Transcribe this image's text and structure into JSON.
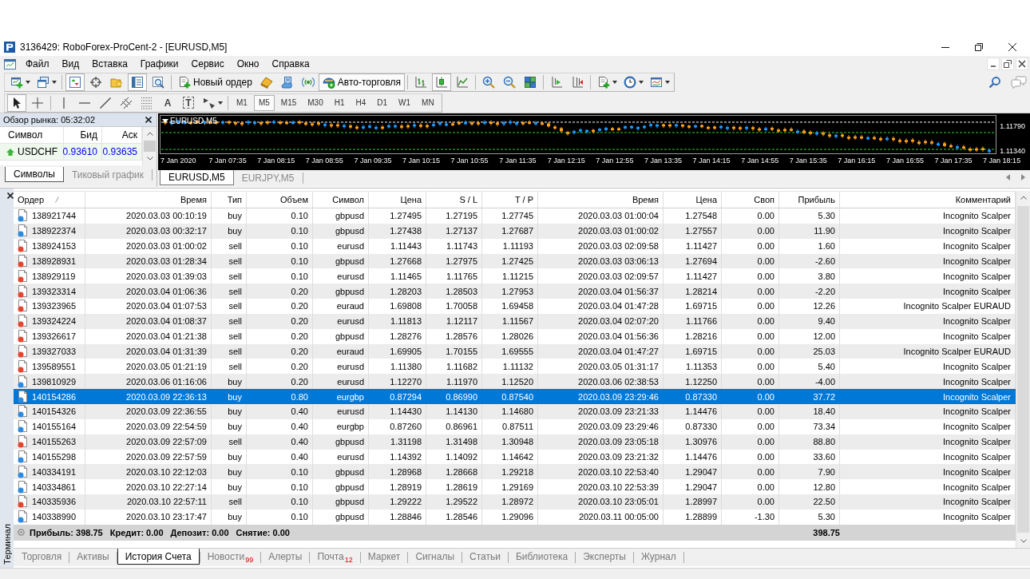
{
  "window": {
    "title": "3136429: RoboForex-ProCent-2 - [EURUSD,M5]"
  },
  "menu": [
    "Файл",
    "Вид",
    "Вставка",
    "Графики",
    "Сервис",
    "Окно",
    "Справка"
  ],
  "toolbar": {
    "groups": [
      [
        {
          "pressed": false
        },
        {
          "pressed": false
        }
      ],
      [
        {
          "pressed": true
        },
        {
          "pressed": false
        },
        {
          "pressed": false
        },
        {
          "pressed": true
        },
        {
          "pressed": false
        }
      ],
      [
        {
          "label": "Новый ордер",
          "pressed": false
        },
        {
          "pressed": false
        },
        {
          "pressed": false
        },
        {
          "pressed": false
        },
        {
          "label": "Авто-торговля",
          "pressed": true
        }
      ],
      [
        {
          "pressed": false
        },
        {
          "pressed": true
        },
        {
          "pressed": false
        }
      ],
      [
        {
          "pressed": false
        },
        {
          "pressed": false
        },
        {
          "pressed": false
        }
      ],
      [
        {
          "pressed": false
        },
        {
          "pressed": false
        }
      ],
      [
        {
          "pressed": false
        },
        {
          "pressed": false
        },
        {
          "pressed": false
        }
      ]
    ]
  },
  "drawing_tools": {
    "groups": [
      [
        {
          "pressed": true
        },
        {
          "pressed": false
        }
      ],
      [
        {
          "pressed": false
        },
        {
          "pressed": false
        },
        {
          "pressed": false
        },
        {
          "pressed": false
        },
        {
          "pressed": false
        },
        {
          "glyph": "A",
          "pressed": false
        },
        {
          "glyph": "T",
          "pressed": false
        },
        {
          "pressed": false
        }
      ]
    ]
  },
  "periods": [
    {
      "label": "M1",
      "selected": false
    },
    {
      "label": "M5",
      "selected": true
    },
    {
      "label": "M15",
      "selected": false
    },
    {
      "label": "M30",
      "selected": false
    },
    {
      "label": "H1",
      "selected": false
    },
    {
      "label": "H4",
      "selected": false
    },
    {
      "label": "D1",
      "selected": false
    },
    {
      "label": "W1",
      "selected": false
    },
    {
      "label": "MN",
      "selected": false
    }
  ],
  "market_watch": {
    "title": "Обзор рынка: 05:32:02",
    "columns": [
      "Символ",
      "Бид",
      "Аск"
    ],
    "rows": [
      {
        "symbol": "USDCHF",
        "bid": "0.93610",
        "ask": "0.93635",
        "rising": true
      }
    ],
    "tabs": [
      {
        "label": "Символы",
        "selected": true
      },
      {
        "label": "Тиковый график",
        "selected": false
      }
    ]
  },
  "chart": {
    "symbol": "EURUSD,M5",
    "price_labels": [
      "1.11790",
      "1.11340"
    ],
    "time_labels": [
      "7 Jan 2020",
      "7 Jan 07:35",
      "7 Jan 08:15",
      "7 Jan 08:55",
      "7 Jan 09:35",
      "7 Jan 10:15",
      "7 Jan 10:55",
      "7 Jan 11:35",
      "7 Jan 12:15",
      "7 Jan 12:55",
      "7 Jan 13:35",
      "7 Jan 14:15",
      "7 Jan 14:55",
      "7 Jan 15:35",
      "7 Jan 16:15",
      "7 Jan 16:55",
      "7 Jan 17:35",
      "7 Jan 18:15"
    ]
  },
  "chart_tabs": [
    {
      "label": "EURUSD,M5",
      "selected": true
    },
    {
      "label": "EURJPY,M5",
      "selected": false
    }
  ],
  "terminal": {
    "title": "Терминал",
    "columns": [
      {
        "label": "Ордер",
        "sorted": true
      },
      {
        "label": "Время",
        "sorted": false
      },
      {
        "label": "Тип",
        "sorted": false
      },
      {
        "label": "Объем",
        "sorted": false
      },
      {
        "label": "Символ",
        "sorted": false
      },
      {
        "label": "Цена",
        "sorted": false
      },
      {
        "label": "S / L",
        "sorted": false
      },
      {
        "label": "T / P",
        "sorted": false
      },
      {
        "label": "Время",
        "sorted": false
      },
      {
        "label": "Цена",
        "sorted": false
      },
      {
        "label": "Своп",
        "sorted": false
      },
      {
        "label": "Прибыль",
        "sorted": false
      },
      {
        "label": "Комментарий",
        "sorted": false
      }
    ],
    "rows": [
      {
        "order": "138921744",
        "open_time": "2020.03.03 00:10:19",
        "type": "buy",
        "volume": "0.10",
        "symbol": "gbpusd",
        "price": "1.27495",
        "sl": "1.27195",
        "tp": "1.27745",
        "close_time": "2020.03.03 01:00:04",
        "close_price": "1.27548",
        "swap": "0.00",
        "profit": "5.30",
        "comment": "Incognito Scalper",
        "color": "#2d8ae0",
        "selected": false
      },
      {
        "order": "138922374",
        "open_time": "2020.03.03 00:32:17",
        "type": "buy",
        "volume": "0.10",
        "symbol": "gbpusd",
        "price": "1.27438",
        "sl": "1.27137",
        "tp": "1.27687",
        "close_time": "2020.03.03 01:00:02",
        "close_price": "1.27557",
        "swap": "0.00",
        "profit": "11.90",
        "comment": "Incognito Scalper",
        "color": "#2d8ae0",
        "selected": false
      },
      {
        "order": "138924153",
        "open_time": "2020.03.03 01:00:02",
        "type": "sell",
        "volume": "0.10",
        "symbol": "eurusd",
        "price": "1.11443",
        "sl": "1.11743",
        "tp": "1.11193",
        "close_time": "2020.03.03 02:09:58",
        "close_price": "1.11427",
        "swap": "0.00",
        "profit": "1.60",
        "comment": "Incognito Scalper",
        "color": "#e5452d",
        "selected": false
      },
      {
        "order": "138928931",
        "open_time": "2020.03.03 01:28:34",
        "type": "sell",
        "volume": "0.10",
        "symbol": "gbpusd",
        "price": "1.27668",
        "sl": "1.27975",
        "tp": "1.27425",
        "close_time": "2020.03.03 03:06:13",
        "close_price": "1.27694",
        "swap": "0.00",
        "profit": "-2.60",
        "comment": "Incognito Scalper",
        "color": "#e5452d",
        "selected": false
      },
      {
        "order": "138929119",
        "open_time": "2020.03.03 01:39:03",
        "type": "sell",
        "volume": "0.10",
        "symbol": "eurusd",
        "price": "1.11465",
        "sl": "1.11765",
        "tp": "1.11215",
        "close_time": "2020.03.03 02:09:57",
        "close_price": "1.11427",
        "swap": "0.00",
        "profit": "3.80",
        "comment": "Incognito Scalper",
        "color": "#e5452d",
        "selected": false
      },
      {
        "order": "139323314",
        "open_time": "2020.03.04 01:06:36",
        "type": "sell",
        "volume": "0.20",
        "symbol": "gbpusd",
        "price": "1.28203",
        "sl": "1.28503",
        "tp": "1.27953",
        "close_time": "2020.03.04 01:56:37",
        "close_price": "1.28214",
        "swap": "0.00",
        "profit": "-2.20",
        "comment": "Incognito Scalper",
        "color": "#e5452d",
        "selected": false
      },
      {
        "order": "139323965",
        "open_time": "2020.03.04 01:07:53",
        "type": "sell",
        "volume": "0.20",
        "symbol": "euraud",
        "price": "1.69808",
        "sl": "1.70058",
        "tp": "1.69458",
        "close_time": "2020.03.04 01:47:28",
        "close_price": "1.69715",
        "swap": "0.00",
        "profit": "12.26",
        "comment": "Incognito Scalper EURAUD",
        "color": "#e5452d",
        "selected": false
      },
      {
        "order": "139324224",
        "open_time": "2020.03.04 01:08:37",
        "type": "sell",
        "volume": "0.20",
        "symbol": "eurusd",
        "price": "1.11813",
        "sl": "1.12117",
        "tp": "1.11567",
        "close_time": "2020.03.04 02:07:20",
        "close_price": "1.11766",
        "swap": "0.00",
        "profit": "9.40",
        "comment": "Incognito Scalper",
        "color": "#e5452d",
        "selected": false
      },
      {
        "order": "139326617",
        "open_time": "2020.03.04 01:21:38",
        "type": "sell",
        "volume": "0.20",
        "symbol": "gbpusd",
        "price": "1.28276",
        "sl": "1.28576",
        "tp": "1.28026",
        "close_time": "2020.03.04 01:56:36",
        "close_price": "1.28216",
        "swap": "0.00",
        "profit": "12.00",
        "comment": "Incognito Scalper",
        "color": "#e5452d",
        "selected": false
      },
      {
        "order": "139327033",
        "open_time": "2020.03.04 01:31:39",
        "type": "sell",
        "volume": "0.20",
        "symbol": "euraud",
        "price": "1.69905",
        "sl": "1.70155",
        "tp": "1.69555",
        "close_time": "2020.03.04 01:47:27",
        "close_price": "1.69715",
        "swap": "0.00",
        "profit": "25.03",
        "comment": "Incognito Scalper EURAUD",
        "color": "#e5452d",
        "selected": false
      },
      {
        "order": "139589551",
        "open_time": "2020.03.05 01:21:19",
        "type": "sell",
        "volume": "0.20",
        "symbol": "eurusd",
        "price": "1.11380",
        "sl": "1.11682",
        "tp": "1.11132",
        "close_time": "2020.03.05 01:31:17",
        "close_price": "1.11353",
        "swap": "0.00",
        "profit": "5.40",
        "comment": "Incognito Scalper",
        "color": "#e5452d",
        "selected": false
      },
      {
        "order": "139810929",
        "open_time": "2020.03.06 01:16:06",
        "type": "buy",
        "volume": "0.20",
        "symbol": "eurusd",
        "price": "1.12270",
        "sl": "1.11970",
        "tp": "1.12520",
        "close_time": "2020.03.06 02:38:53",
        "close_price": "1.12250",
        "swap": "0.00",
        "profit": "-4.00",
        "comment": "Incognito Scalper",
        "color": "#2d8ae0",
        "selected": false
      },
      {
        "order": "140154286",
        "open_time": "2020.03.09 22:36:13",
        "type": "buy",
        "volume": "0.80",
        "symbol": "eurgbp",
        "price": "0.87294",
        "sl": "0.86990",
        "tp": "0.87540",
        "close_time": "2020.03.09 23:29:46",
        "close_price": "0.87330",
        "swap": "0.00",
        "profit": "37.72",
        "comment": "Incognito Scalper",
        "color": "#2d8ae0",
        "selected": true
      },
      {
        "order": "140154326",
        "open_time": "2020.03.09 22:36:55",
        "type": "buy",
        "volume": "0.40",
        "symbol": "eurusd",
        "price": "1.14430",
        "sl": "1.14130",
        "tp": "1.14680",
        "close_time": "2020.03.09 23:21:33",
        "close_price": "1.14476",
        "swap": "0.00",
        "profit": "18.40",
        "comment": "Incognito Scalper",
        "color": "#2d8ae0",
        "selected": false
      },
      {
        "order": "140155164",
        "open_time": "2020.03.09 22:54:59",
        "type": "buy",
        "volume": "0.40",
        "symbol": "eurgbp",
        "price": "0.87260",
        "sl": "0.86961",
        "tp": "0.87511",
        "close_time": "2020.03.09 23:29:46",
        "close_price": "0.87330",
        "swap": "0.00",
        "profit": "73.34",
        "comment": "Incognito Scalper",
        "color": "#2d8ae0",
        "selected": false
      },
      {
        "order": "140155263",
        "open_time": "2020.03.09 22:57:09",
        "type": "sell",
        "volume": "0.40",
        "symbol": "gbpusd",
        "price": "1.31198",
        "sl": "1.31498",
        "tp": "1.30948",
        "close_time": "2020.03.09 23:05:18",
        "close_price": "1.30976",
        "swap": "0.00",
        "profit": "88.80",
        "comment": "Incognito Scalper",
        "color": "#e5452d",
        "selected": false
      },
      {
        "order": "140155298",
        "open_time": "2020.03.09 22:57:59",
        "type": "buy",
        "volume": "0.40",
        "symbol": "eurusd",
        "price": "1.14392",
        "sl": "1.14092",
        "tp": "1.14642",
        "close_time": "2020.03.09 23:21:32",
        "close_price": "1.14476",
        "swap": "0.00",
        "profit": "33.60",
        "comment": "Incognito Scalper",
        "color": "#2d8ae0",
        "selected": false
      },
      {
        "order": "140334191",
        "open_time": "2020.03.10 22:12:03",
        "type": "buy",
        "volume": "0.10",
        "symbol": "gbpusd",
        "price": "1.28968",
        "sl": "1.28668",
        "tp": "1.29218",
        "close_time": "2020.03.10 22:53:40",
        "close_price": "1.29047",
        "swap": "0.00",
        "profit": "7.90",
        "comment": "Incognito Scalper",
        "color": "#2d8ae0",
        "selected": false
      },
      {
        "order": "140334861",
        "open_time": "2020.03.10 22:27:14",
        "type": "buy",
        "volume": "0.10",
        "symbol": "gbpusd",
        "price": "1.28919",
        "sl": "1.28619",
        "tp": "1.29169",
        "close_time": "2020.03.10 22:53:39",
        "close_price": "1.29047",
        "swap": "0.00",
        "profit": "12.80",
        "comment": "Incognito Scalper",
        "color": "#2d8ae0",
        "selected": false
      },
      {
        "order": "140335936",
        "open_time": "2020.03.10 22:57:11",
        "type": "sell",
        "volume": "0.10",
        "symbol": "gbpusd",
        "price": "1.29222",
        "sl": "1.29522",
        "tp": "1.28972",
        "close_time": "2020.03.10 23:05:01",
        "close_price": "1.28997",
        "swap": "0.00",
        "profit": "22.50",
        "comment": "Incognito Scalper",
        "color": "#e5452d",
        "selected": false
      },
      {
        "order": "140338990",
        "open_time": "2020.03.10 23:17:47",
        "type": "buy",
        "volume": "0.10",
        "symbol": "gbpusd",
        "price": "1.28846",
        "sl": "1.28546",
        "tp": "1.29096",
        "close_time": "2020.03.11 00:05:00",
        "close_price": "1.28899",
        "swap": "-1.30",
        "profit": "5.30",
        "comment": "Incognito Scalper",
        "color": "#2d8ae0",
        "selected": false
      }
    ],
    "summary": {
      "items": [
        "Прибыль: 398.75",
        "Кредит: 0.00",
        "Депозит: 0.00",
        "Снятие: 0.00"
      ],
      "profit": "398.75"
    },
    "tabs": [
      {
        "label": "Торговля",
        "selected": false
      },
      {
        "label": "Активы",
        "selected": false
      },
      {
        "label": "История Счета",
        "selected": true
      },
      {
        "label": "Новости",
        "count": "99",
        "selected": false
      },
      {
        "label": "Алерты",
        "selected": false
      },
      {
        "label": "Почта",
        "count": "12",
        "selected": false
      },
      {
        "label": "Маркет",
        "selected": false
      },
      {
        "label": "Сигналы",
        "selected": false
      },
      {
        "label": "Статьи",
        "selected": false
      },
      {
        "label": "Библиотека",
        "selected": false
      },
      {
        "label": "Эксперты",
        "selected": false
      },
      {
        "label": "Журнал",
        "selected": false
      }
    ]
  }
}
